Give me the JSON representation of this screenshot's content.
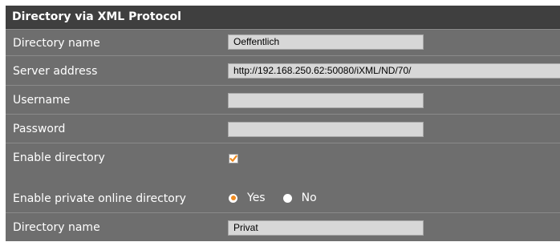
{
  "section": {
    "title": "Directory via XML Protocol"
  },
  "rows": {
    "directory_name": {
      "label": "Directory name",
      "value": "Oeffentlich"
    },
    "server_address": {
      "label": "Server address",
      "value": "http://192.168.250.62:50080/iXML/ND/70/"
    },
    "username": {
      "label": "Username",
      "value": ""
    },
    "password": {
      "label": "Password",
      "value": ""
    },
    "enable_directory": {
      "label": "Enable directory",
      "checked": true
    },
    "enable_private": {
      "label": "Enable private online directory",
      "options": [
        "Yes",
        "No"
      ],
      "selected": "Yes"
    },
    "private_directory_name": {
      "label": "Directory name",
      "value": "Privat"
    }
  },
  "colors": {
    "panel_bg": "#6e6e6e",
    "header_bg": "#3f3f3f",
    "accent": "#f08a1e",
    "field_bg": "#d7d7d7"
  }
}
